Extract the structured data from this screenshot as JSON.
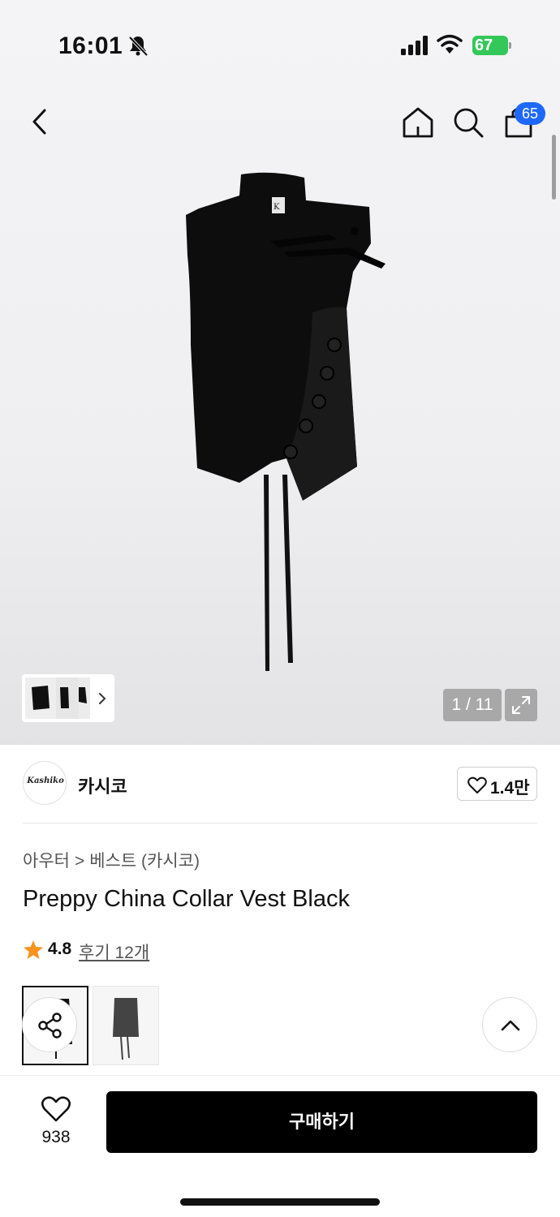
{
  "status_bar": {
    "time": "16:01",
    "battery": "67",
    "icons": [
      "bell-slash-icon",
      "cellular-signal-icon",
      "wifi-icon",
      "battery-charging-icon"
    ]
  },
  "nav": {
    "cart_badge": "65",
    "icons": [
      "chevron-left-icon",
      "home-icon",
      "search-icon",
      "shopping-bag-icon"
    ]
  },
  "gallery": {
    "counter": "1 / 11",
    "icons": [
      "expand-icon",
      "chevron-right-icon"
    ]
  },
  "brand": {
    "logo_text": "Kashiko",
    "name": "카시코",
    "likes": "1.4만",
    "icons": [
      "heart-outline-icon"
    ]
  },
  "breadcrumb": {
    "category": "아우터",
    "separator": ">",
    "subcategory": "베스트 (카시코)"
  },
  "product": {
    "title": "Preppy China Collar Vest Black",
    "rating": "4.8",
    "reviews": "후기 12개"
  },
  "floating": {
    "icons": [
      "share-icon",
      "chevron-up-icon"
    ]
  },
  "bottom": {
    "wish_count": "938",
    "buy_label": "구매하기"
  },
  "colors": {
    "accent_badge": "#1f68ff",
    "battery": "#34c759",
    "star": "#f7931e",
    "buy_button": "#000000"
  }
}
